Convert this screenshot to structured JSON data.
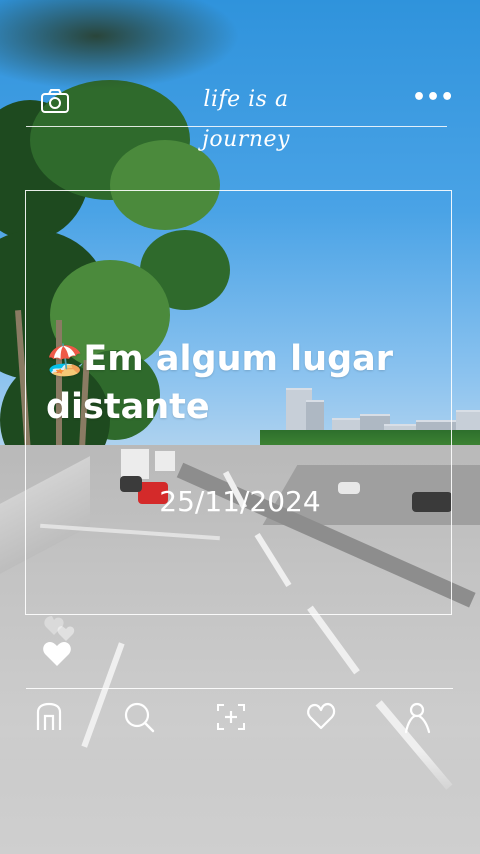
{
  "header": {
    "title": "life is a journey",
    "camera_icon": "camera-icon",
    "more_icon": "more-dots-icon"
  },
  "post": {
    "caption_emoji": "🏖️",
    "caption_text": "Em algum lugar distante",
    "date": "25/11/2024"
  },
  "like": {
    "icon": "heart-icon"
  },
  "bottom_nav": {
    "items": [
      {
        "icon": "home-icon"
      },
      {
        "icon": "search-icon"
      },
      {
        "icon": "add-post-icon"
      },
      {
        "icon": "heart-outline-icon"
      },
      {
        "icon": "profile-icon"
      }
    ]
  },
  "colors": {
    "overlay_text": "#ffffff",
    "sky": "#3c9be0"
  }
}
